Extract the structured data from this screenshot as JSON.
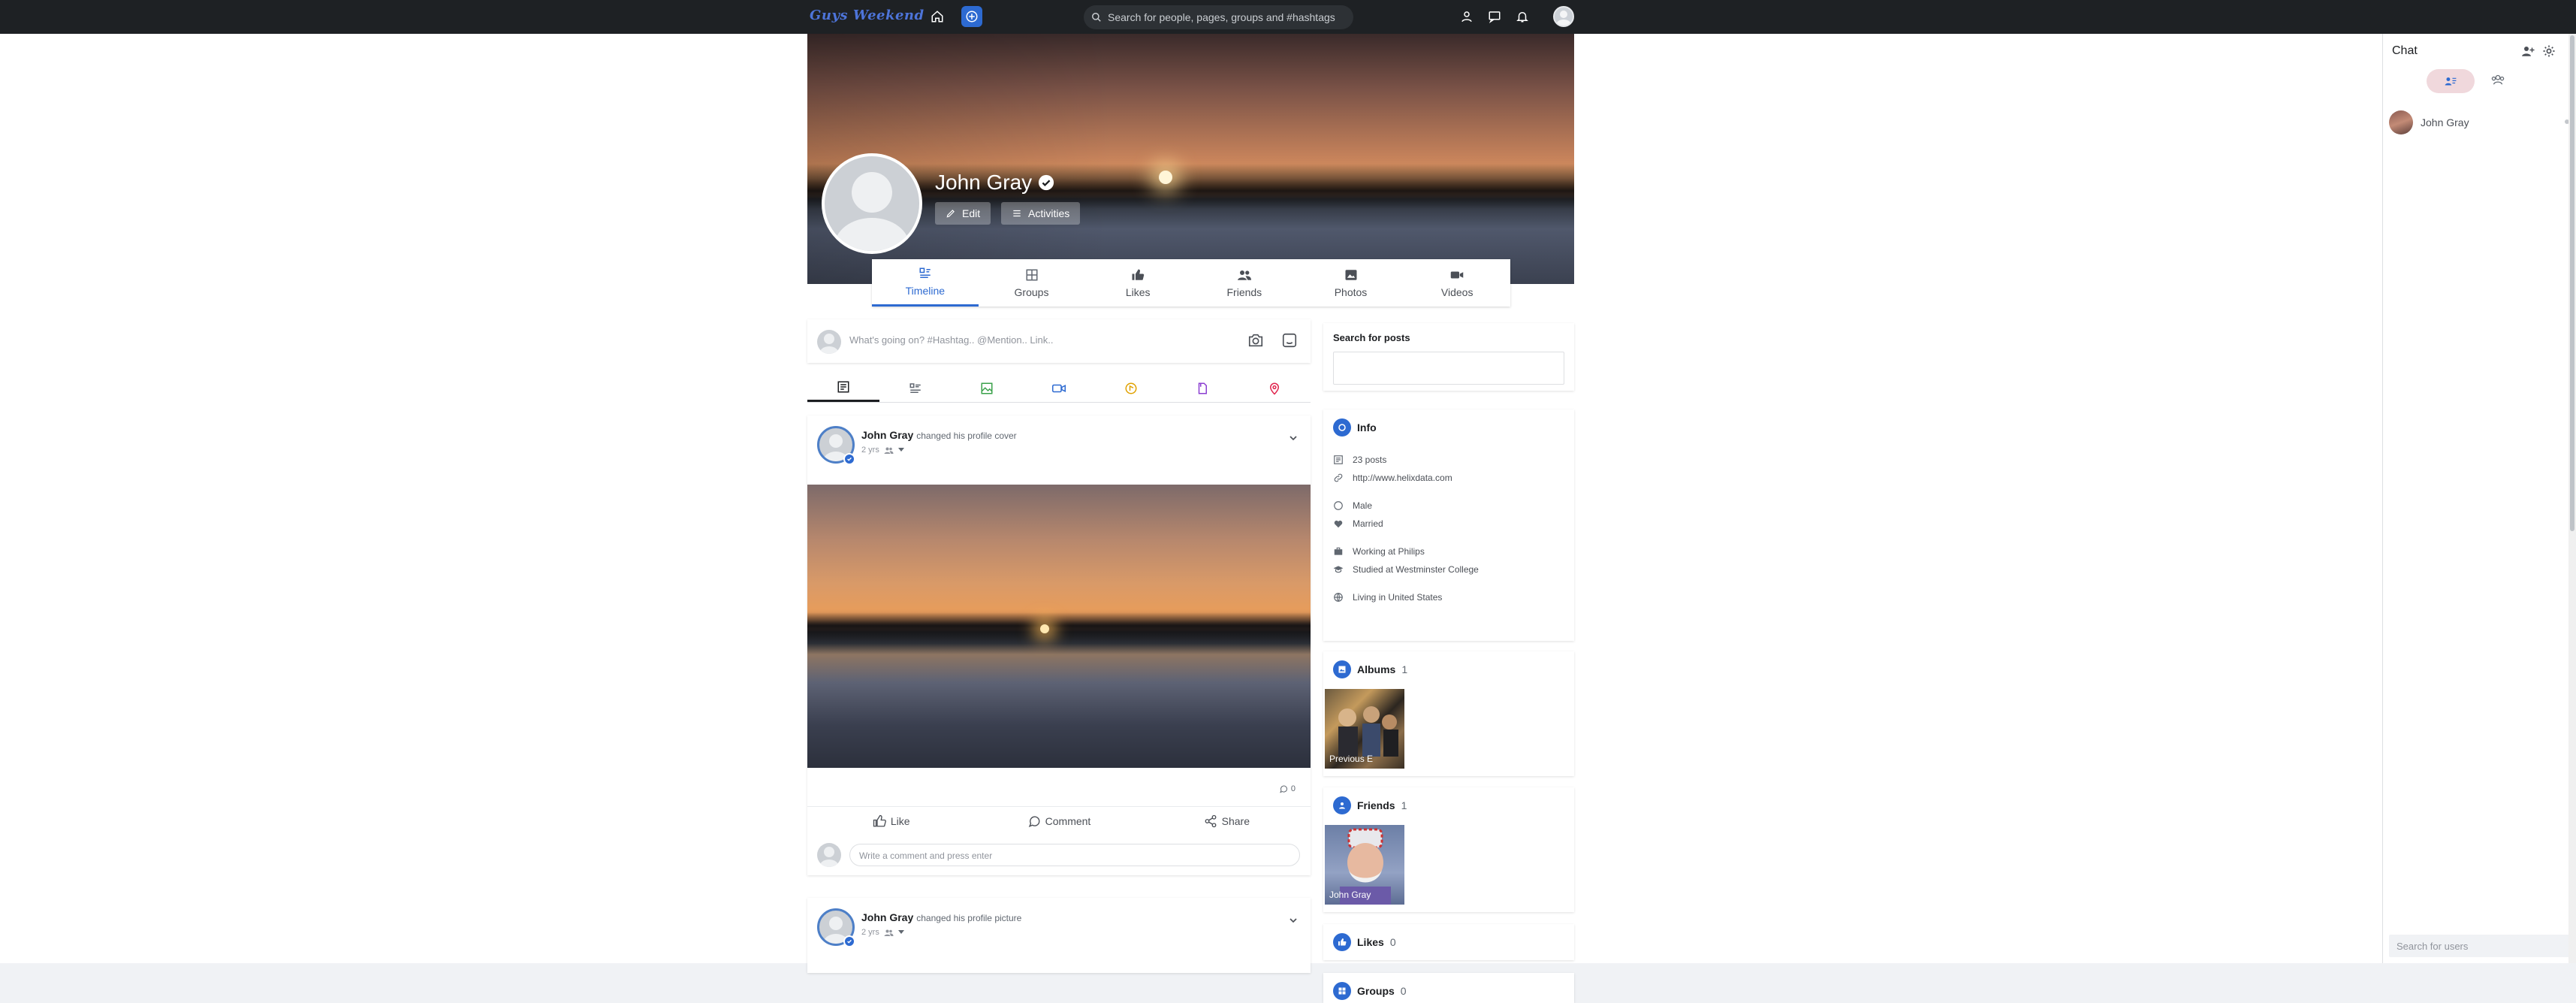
{
  "topbar": {
    "logo": "Guys Weekend",
    "search_placeholder": "Search for people, pages, groups and #hashtags"
  },
  "profile": {
    "name": "John Gray",
    "edit_label": "Edit",
    "activities_label": "Activities"
  },
  "tabs": [
    {
      "label": "Timeline"
    },
    {
      "label": "Groups"
    },
    {
      "label": "Likes"
    },
    {
      "label": "Friends"
    },
    {
      "label": "Photos"
    },
    {
      "label": "Videos"
    }
  ],
  "composer": {
    "placeholder": "What's going on? #Hashtag.. @Mention.. Link.."
  },
  "posts": [
    {
      "author": "John Gray",
      "action": "changed his profile cover",
      "time": "2 yrs",
      "comment_count": "0",
      "like_label": "Like",
      "comment_label": "Comment",
      "share_label": "Share",
      "comment_placeholder": "Write a comment and press enter"
    },
    {
      "author": "John Gray",
      "action": "changed his profile picture",
      "time": "2 yrs"
    }
  ],
  "sidebar": {
    "search_posts_label": "Search for posts",
    "info_title": "Info",
    "info": {
      "posts": "23 posts",
      "website": "http://www.helixdata.com",
      "gender": "Male",
      "relationship": "Married",
      "work": "Working at Philips",
      "school": "Studied at Westminster College",
      "location": "Living in United States"
    },
    "albums_title": "Albums",
    "albums_count": "1",
    "album_label": "Previous E",
    "friends_title": "Friends",
    "friends_count": "1",
    "friend_label": "John Gray",
    "likes_title": "Likes",
    "likes_count": "0",
    "groups_title": "Groups",
    "groups_count": "0"
  },
  "chat": {
    "title": "Chat",
    "contact": "John Gray",
    "search_placeholder": "Search for users"
  },
  "colors": {
    "accent": "#2d6ad1",
    "topbar": "#1e2124"
  }
}
